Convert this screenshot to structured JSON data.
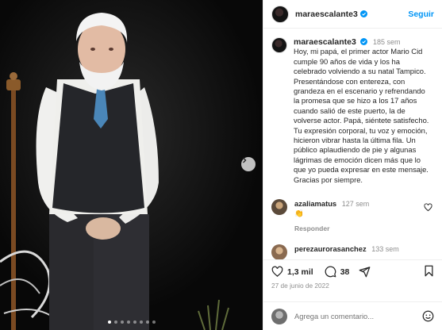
{
  "post": {
    "author": "maraescalante3",
    "follow_label": "Seguir",
    "more_label": "•••",
    "time_ago": "185 sem",
    "caption": "Hoy, mi papá, el primer actor Mario Cid cumple 90 años de vida y los ha celebrado volviendo a su natal Tampico. Presentándose con entereza, con grandeza en el escenario y refrendando la promesa que se hizo a los 17 años cuando salió de este puerto, la de volverse actor. Papá, siéntete satisfecho. Tu expresión corporal, tu voz y emoción, hicieron vibrar hasta la última fila. Un público aplaudiendo de pie y algunas lágrimas de emoción dicen más que lo que yo pueda expresar en este mensaje. Gracias por siempre.",
    "likes": "1,3 mil",
    "comments_count": "38",
    "date": "27 de junio de 2022"
  },
  "comments": [
    {
      "user": "azaliamatus",
      "time": "127 sem",
      "text": "👏",
      "reply_label": "Responder"
    },
    {
      "user": "perezaurorasanchez",
      "time": "133 sem",
      "text": "",
      "reply_label": ""
    }
  ],
  "add_comment": {
    "placeholder": "Agrega un comentario..."
  },
  "carousel": {
    "total": 8,
    "active": 1
  },
  "icons": {
    "verified": "verified-badge-icon",
    "like": "heart-icon",
    "comment": "comment-bubble-icon",
    "share": "paper-plane-icon",
    "save": "bookmark-icon",
    "emoji": "smiley-icon",
    "next": "chevron-right-icon"
  },
  "colors": {
    "accent": "#0095f6",
    "verified": "#0095f6",
    "muted": "#8e8e8e"
  }
}
